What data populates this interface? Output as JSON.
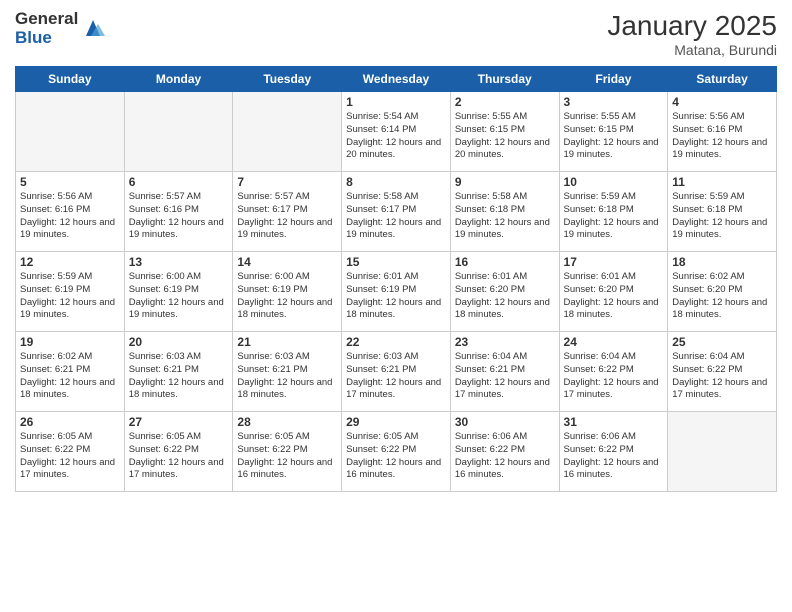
{
  "logo": {
    "general": "General",
    "blue": "Blue"
  },
  "title": "January 2025",
  "subtitle": "Matana, Burundi",
  "headers": [
    "Sunday",
    "Monday",
    "Tuesday",
    "Wednesday",
    "Thursday",
    "Friday",
    "Saturday"
  ],
  "weeks": [
    [
      {
        "num": "",
        "info": ""
      },
      {
        "num": "",
        "info": ""
      },
      {
        "num": "",
        "info": ""
      },
      {
        "num": "1",
        "info": "Sunrise: 5:54 AM\nSunset: 6:14 PM\nDaylight: 12 hours\nand 20 minutes."
      },
      {
        "num": "2",
        "info": "Sunrise: 5:55 AM\nSunset: 6:15 PM\nDaylight: 12 hours\nand 20 minutes."
      },
      {
        "num": "3",
        "info": "Sunrise: 5:55 AM\nSunset: 6:15 PM\nDaylight: 12 hours\nand 19 minutes."
      },
      {
        "num": "4",
        "info": "Sunrise: 5:56 AM\nSunset: 6:16 PM\nDaylight: 12 hours\nand 19 minutes."
      }
    ],
    [
      {
        "num": "5",
        "info": "Sunrise: 5:56 AM\nSunset: 6:16 PM\nDaylight: 12 hours\nand 19 minutes."
      },
      {
        "num": "6",
        "info": "Sunrise: 5:57 AM\nSunset: 6:16 PM\nDaylight: 12 hours\nand 19 minutes."
      },
      {
        "num": "7",
        "info": "Sunrise: 5:57 AM\nSunset: 6:17 PM\nDaylight: 12 hours\nand 19 minutes."
      },
      {
        "num": "8",
        "info": "Sunrise: 5:58 AM\nSunset: 6:17 PM\nDaylight: 12 hours\nand 19 minutes."
      },
      {
        "num": "9",
        "info": "Sunrise: 5:58 AM\nSunset: 6:18 PM\nDaylight: 12 hours\nand 19 minutes."
      },
      {
        "num": "10",
        "info": "Sunrise: 5:59 AM\nSunset: 6:18 PM\nDaylight: 12 hours\nand 19 minutes."
      },
      {
        "num": "11",
        "info": "Sunrise: 5:59 AM\nSunset: 6:18 PM\nDaylight: 12 hours\nand 19 minutes."
      }
    ],
    [
      {
        "num": "12",
        "info": "Sunrise: 5:59 AM\nSunset: 6:19 PM\nDaylight: 12 hours\nand 19 minutes."
      },
      {
        "num": "13",
        "info": "Sunrise: 6:00 AM\nSunset: 6:19 PM\nDaylight: 12 hours\nand 19 minutes."
      },
      {
        "num": "14",
        "info": "Sunrise: 6:00 AM\nSunset: 6:19 PM\nDaylight: 12 hours\nand 18 minutes."
      },
      {
        "num": "15",
        "info": "Sunrise: 6:01 AM\nSunset: 6:19 PM\nDaylight: 12 hours\nand 18 minutes."
      },
      {
        "num": "16",
        "info": "Sunrise: 6:01 AM\nSunset: 6:20 PM\nDaylight: 12 hours\nand 18 minutes."
      },
      {
        "num": "17",
        "info": "Sunrise: 6:01 AM\nSunset: 6:20 PM\nDaylight: 12 hours\nand 18 minutes."
      },
      {
        "num": "18",
        "info": "Sunrise: 6:02 AM\nSunset: 6:20 PM\nDaylight: 12 hours\nand 18 minutes."
      }
    ],
    [
      {
        "num": "19",
        "info": "Sunrise: 6:02 AM\nSunset: 6:21 PM\nDaylight: 12 hours\nand 18 minutes."
      },
      {
        "num": "20",
        "info": "Sunrise: 6:03 AM\nSunset: 6:21 PM\nDaylight: 12 hours\nand 18 minutes."
      },
      {
        "num": "21",
        "info": "Sunrise: 6:03 AM\nSunset: 6:21 PM\nDaylight: 12 hours\nand 18 minutes."
      },
      {
        "num": "22",
        "info": "Sunrise: 6:03 AM\nSunset: 6:21 PM\nDaylight: 12 hours\nand 17 minutes."
      },
      {
        "num": "23",
        "info": "Sunrise: 6:04 AM\nSunset: 6:21 PM\nDaylight: 12 hours\nand 17 minutes."
      },
      {
        "num": "24",
        "info": "Sunrise: 6:04 AM\nSunset: 6:22 PM\nDaylight: 12 hours\nand 17 minutes."
      },
      {
        "num": "25",
        "info": "Sunrise: 6:04 AM\nSunset: 6:22 PM\nDaylight: 12 hours\nand 17 minutes."
      }
    ],
    [
      {
        "num": "26",
        "info": "Sunrise: 6:05 AM\nSunset: 6:22 PM\nDaylight: 12 hours\nand 17 minutes."
      },
      {
        "num": "27",
        "info": "Sunrise: 6:05 AM\nSunset: 6:22 PM\nDaylight: 12 hours\nand 17 minutes."
      },
      {
        "num": "28",
        "info": "Sunrise: 6:05 AM\nSunset: 6:22 PM\nDaylight: 12 hours\nand 16 minutes."
      },
      {
        "num": "29",
        "info": "Sunrise: 6:05 AM\nSunset: 6:22 PM\nDaylight: 12 hours\nand 16 minutes."
      },
      {
        "num": "30",
        "info": "Sunrise: 6:06 AM\nSunset: 6:22 PM\nDaylight: 12 hours\nand 16 minutes."
      },
      {
        "num": "31",
        "info": "Sunrise: 6:06 AM\nSunset: 6:22 PM\nDaylight: 12 hours\nand 16 minutes."
      },
      {
        "num": "",
        "info": ""
      }
    ]
  ]
}
